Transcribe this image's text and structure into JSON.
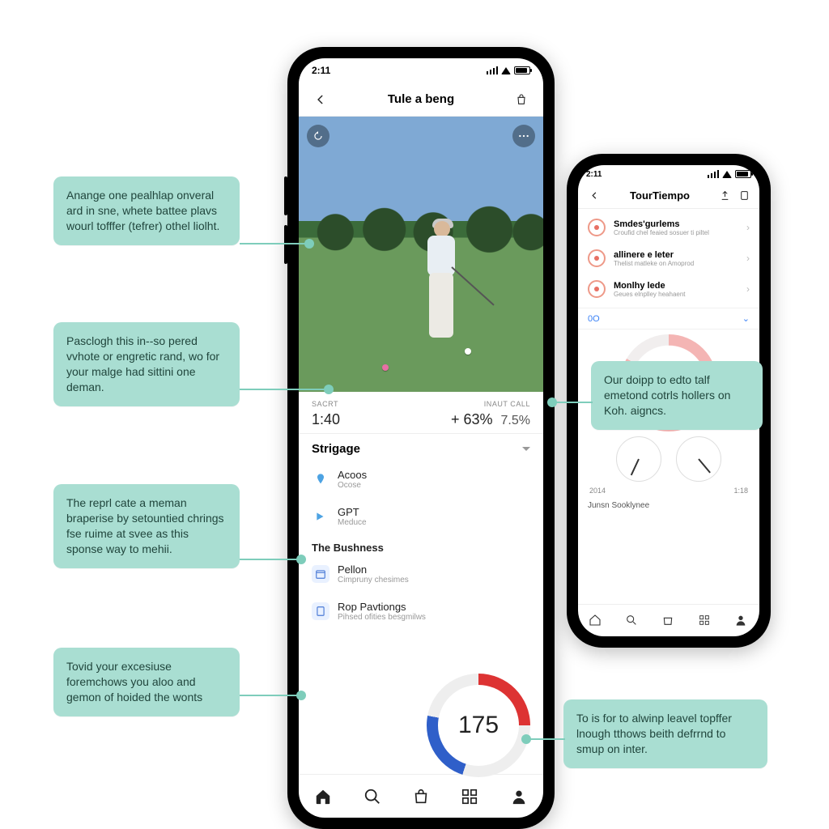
{
  "status": {
    "time": "2:11"
  },
  "phone1": {
    "header": {
      "title": "Tule a beng"
    },
    "metrics": {
      "left_label": "SACRT",
      "left_value": "1:40",
      "right_label": "INAUT CALL",
      "right_value_a": "+ 63%",
      "right_value_b": "7.5%"
    },
    "section": {
      "title": "Strigage"
    },
    "rows": {
      "r1": {
        "title": "Acoos",
        "sub": "Ocose"
      },
      "r2": {
        "title": "GPT",
        "sub": "Meduce"
      }
    },
    "subhead": "The Bushness",
    "rows2": {
      "r3": {
        "title": "Pellon",
        "sub": "Cimpruny chesimes"
      },
      "r4": {
        "title": "Rop Pavtiongs",
        "sub": "Pihsed ofities besgmilws"
      }
    },
    "gauge": {
      "value": "175"
    }
  },
  "phone2": {
    "header": {
      "title": "TourTiempo"
    },
    "items": {
      "i1": {
        "title": "Smdes'gurlems",
        "sub": "Croufid chel feaied sosuer ti piltel"
      },
      "i2": {
        "title": "allinere e leter",
        "sub": "Thelist matleke on Amoprod"
      },
      "i3": {
        "title": "Monlhy lede",
        "sub": "Geues elnplley heahaent"
      }
    },
    "link": {
      "label": "0O"
    },
    "axis": {
      "left": "2014",
      "right": "1:18"
    },
    "caption": "Junsn Sooklynee"
  },
  "callouts": {
    "c1": "Anange one pealhlap onveral ard in sne, whete battee plavs wourl tofffer (tefrer) othel liolht.",
    "c2": "Pasclogh this in--so pered vvhote or engretic rand, wo for your malge had sittini one deman.",
    "c3": "The reprl cate a meman braperise by setountied chrings fse ruime at svee as this sponse way to mehii.",
    "c4": "Tovid your excesiuse foremchows you aloo and gemon of hoided the wonts",
    "c5": "Our doipp to edto talf emetond cotrls hollers on Koh. aigncs.",
    "c6": "To is for to alwinp leavel topffer lnough tthows beith defrrnd to smup on inter."
  }
}
